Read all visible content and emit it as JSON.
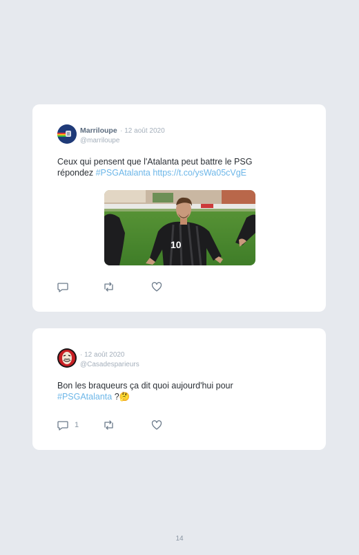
{
  "tweets": [
    {
      "name": "Marriloupe",
      "date": "· 12 août 2020",
      "handle": "@marriloupe",
      "text_plain": "Ceux qui pensent que l'Atalanta peut battre le PSG répondez ",
      "hashtag": "#PSGAtalanta",
      "url": "https://t.co/ysWa05cVgE",
      "reply_count": "",
      "icons": [
        "reply-icon",
        "retweet-icon",
        "like-icon"
      ]
    },
    {
      "name": "",
      "date": "· 12 août 2020",
      "handle": "@Casadesparieurs",
      "text_plain": "Bon les braqueurs ça dit quoi aujourd'hui pour ",
      "hashtag": "#PSGAtalanta",
      "emoji": " ?🤔",
      "reply_count": "1",
      "icons": [
        "reply-icon",
        "retweet-icon",
        "like-icon"
      ]
    }
  ],
  "page_number": "14",
  "colors": {
    "background": "#e6e9ee",
    "card": "#ffffff",
    "link": "#6cb6e8",
    "muted": "#a4afbb"
  }
}
